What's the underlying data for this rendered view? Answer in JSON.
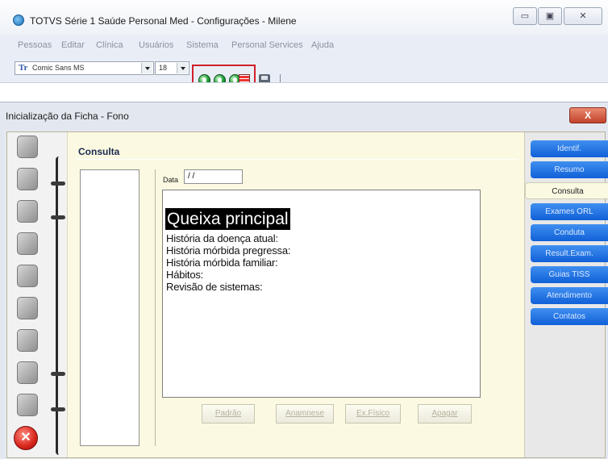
{
  "window": {
    "title": "TOTVS Série 1 Saúde Personal Med - Configurações - Milene",
    "min_label": "▭",
    "max_label": "▣",
    "close_label": "✕"
  },
  "menu": [
    {
      "label": "Pessoas"
    },
    {
      "label": "Editar"
    },
    {
      "label": "Clínica"
    },
    {
      "label": "Usuários"
    },
    {
      "label": "Sistema"
    },
    {
      "label": "Personal Services"
    },
    {
      "label": "Ajuda"
    }
  ],
  "toolbar": {
    "font_icon": "Tr",
    "font": "Comic Sans MS",
    "size": "18",
    "icons": [
      "green-circle-icon",
      "green-circle-icon",
      "green-circle-icon",
      "grid-icon",
      "print-icon"
    ]
  },
  "dialog": {
    "title": "Inicialização da Ficha - Fono",
    "close_label": "X",
    "section_title": "Consulta",
    "date_label": "Data",
    "date_value": "/ /",
    "editor_heading": "Queixa principal",
    "editor_lines": [
      "História da doença atual:",
      "História mórbida pregressa:",
      "História mórbida familiar:",
      "Hábitos:",
      "Revisão de sistemas:"
    ],
    "buttons": {
      "padrao": "Padrão",
      "anamnese": "Anamnese",
      "exfisico": "Ex.Físico",
      "apagar": "Apagar"
    },
    "tabs": [
      {
        "label": "Identif."
      },
      {
        "label": "Resumo"
      },
      {
        "label": "Consulta",
        "active": true
      },
      {
        "label": "Exames ORL"
      },
      {
        "label": "Conduta"
      },
      {
        "label": "Result.Exam."
      },
      {
        "label": "Guias TISS"
      },
      {
        "label": "Atendimento"
      },
      {
        "label": "Contatos"
      }
    ],
    "exit_label": "✕"
  },
  "colors": {
    "accent_tab": "#1f6fe0",
    "highlight_border": "#d21f2b",
    "panel_bg": "#fbf9e1"
  }
}
